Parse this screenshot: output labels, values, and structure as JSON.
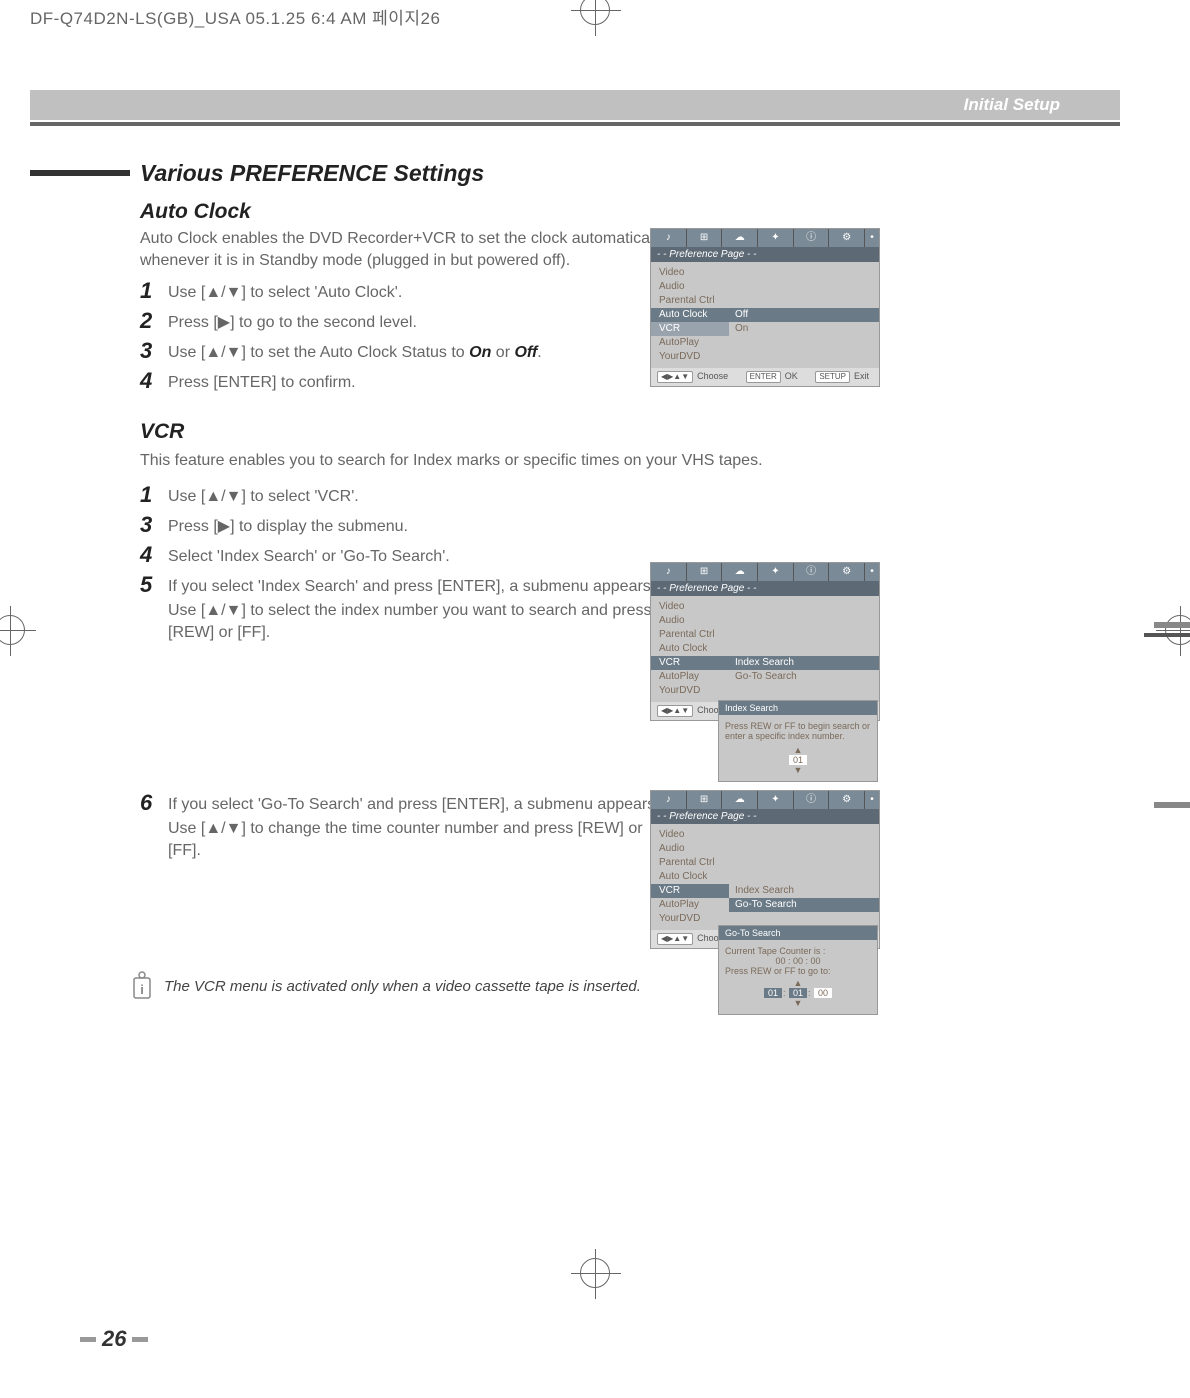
{
  "header": {
    "strip": "DF-Q74D2N-LS(GB)_USA   05.1.25 6:4 AM   페이지26",
    "section_label": "Initial Setup"
  },
  "title": "Various PREFERENCE Settings",
  "autoClock": {
    "heading": "Auto Clock",
    "intro": "Auto Clock enables the DVD Recorder+VCR to set the clock automatically whenever it is in Standby mode (plugged in but powered off).",
    "steps": {
      "s1": "Use [▲/▼] to select 'Auto Clock'.",
      "s2": "Press [▶] to go to the second level.",
      "s3_pre": "Use [▲/▼] to set the Auto Clock Status to ",
      "s3_on": "On",
      "s3_mid": " or ",
      "s3_off": "Off",
      "s3_end": ".",
      "s4": "Press [ENTER] to confirm."
    }
  },
  "vcr": {
    "heading": "VCR",
    "intro": "This feature enables you to search for Index marks or specific times on your VHS tapes.",
    "steps": {
      "s1": "Use [▲/▼] to select 'VCR'.",
      "s3": "Press [▶] to display the submenu.",
      "s4": "Select 'Index Search' or 'Go-To Search'.",
      "s5a": "If you select 'Index Search' and press [ENTER], a submenu appears.",
      "s5b": "Use [▲/▼] to select the index number you want to search and press [REW] or [FF].",
      "s6a": "If you select 'Go-To Search' and press [ENTER], a submenu appears.",
      "s6b": "Use [▲/▼] to change the time counter number and press [REW] or [FF]."
    },
    "note": "The VCR  menu is activated only when a video cassette tape is inserted."
  },
  "osd": {
    "banner": "- - Preference Page - -",
    "menu": {
      "video": "Video",
      "audio": "Audio",
      "parental": "Parental Ctrl",
      "autoClock": "Auto Clock",
      "vcr": "VCR",
      "autoPlay": "AutoPlay",
      "yourDvd": "YourDVD"
    },
    "opts": {
      "off": "Off",
      "on": "On",
      "indexSearch": "Index Search",
      "gotoSearch": "Go-To Search"
    },
    "footer": {
      "choose": "Choose",
      "ok": "OK",
      "exit": "Exit",
      "enter": "ENTER",
      "setup": "SETUP",
      "arrows": "◀▶▲▼"
    }
  },
  "popupIndex": {
    "title": "Index Search",
    "line1": "Press REW or FF to begin search or",
    "line2": "enter a specific index number.",
    "value": "01"
  },
  "popupGoto": {
    "title": "Go-To Search",
    "line1": "Current Tape Counter is :",
    "counter": "00 : 00 : 00",
    "line2": "Press REW or FF to go to:",
    "v1": "01",
    "v2": "01",
    "v3": "00"
  },
  "pageNumber": "26"
}
